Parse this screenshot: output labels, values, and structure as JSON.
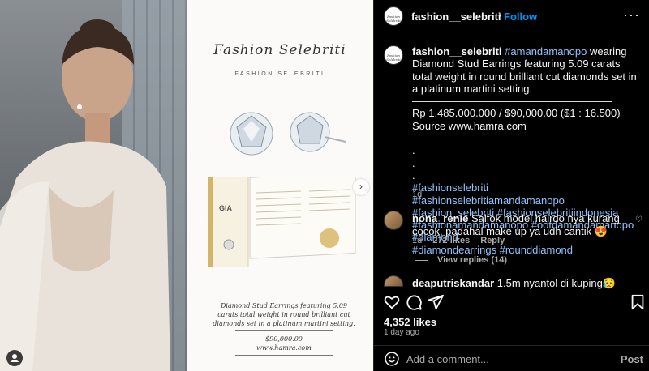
{
  "post": {
    "username": "fashion__selebriti",
    "follow_label": "Follow",
    "page": {
      "brand_script": "Fashion Selebriti",
      "brand_caps": "FASHION SELEBRITI",
      "certificate_label": "GIA",
      "caption_line1": "Diamond Stud Earrings featuring 5.09",
      "caption_line2": "carats total weight in round brilliant cut",
      "caption_line3": "diamonds set in a platinum martini setting.",
      "price": "$90,000.00",
      "site": "www.hamra.com"
    }
  },
  "caption": {
    "username": "fashion__selebriti",
    "mention": "#amandamanopo",
    "text": " wearing Diamond Stud Earrings featuring 5.09 carats total weight in round brilliant cut diamonds set in a platinum martini setting.",
    "rule1": "———————————————————",
    "price": "Rp 1.485.000.000 / $90,000.00 ($1 : 16.500)",
    "source": "Source www.hamra.com",
    "rule2": "————————————————————",
    "dot": ".",
    "hashtags_line1": "#fashionselebriti #fashionselebritiamandamanopo",
    "hashtags_line2": "#fashion_selebriti #fashionselebritiindonesia",
    "hashtags_line3": "#fashionamandamanopo #ootdamandamanopo #diamond",
    "hashtags_line4": "#diamondearrings #rounddiamond",
    "age": "1d"
  },
  "comments": [
    {
      "username": "nona_renie",
      "text": "Salfok model hairdo nya kurang cocok, padahal make up ya udh cantik 😍",
      "age": "1d",
      "likes": "272 likes",
      "reply": "Reply",
      "view_replies": "View replies (14)"
    },
    {
      "username": "deaputriskandar",
      "text": "1.5m nyantol di kuping😥"
    }
  ],
  "stats": {
    "likes": "4,352 likes",
    "ago": "1 day ago"
  },
  "comment_box": {
    "placeholder": "Add a comment...",
    "post_label": "Post"
  },
  "icons": {
    "more": "more-horizontal-icon",
    "heart": "heart-icon",
    "comment": "comment-icon",
    "share": "share-icon",
    "save": "bookmark-icon",
    "emoji": "emoji-icon",
    "next": "chevron-right-icon",
    "tags": "user-tag-icon"
  }
}
